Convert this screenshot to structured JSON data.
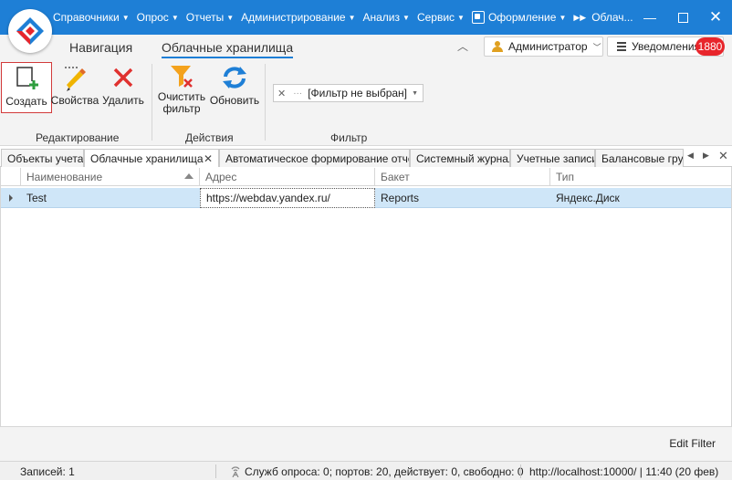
{
  "menu": {
    "items": [
      {
        "label": "Справочники"
      },
      {
        "label": "Опрос"
      },
      {
        "label": "Отчеты"
      },
      {
        "label": "Администрирование"
      },
      {
        "label": "Анализ"
      },
      {
        "label": "Сервис"
      },
      {
        "label": "Оформление"
      }
    ],
    "window_tab": "Облач..."
  },
  "ribbon_tabs": {
    "navigation": "Навигация",
    "cloud": "Облачные хранилища"
  },
  "user": {
    "name": "Администратор",
    "notifications_label": "Уведомления",
    "notifications_count": "1880"
  },
  "ribbon": {
    "create": "Создать",
    "properties": "Свойства",
    "delete": "Удалить",
    "clear_filter_l1": "Очистить",
    "clear_filter_l2": "фильтр",
    "refresh": "Обновить",
    "filter_placeholder": "[Фильтр не выбран]",
    "group_editing": "Редактирование",
    "group_actions": "Действия",
    "group_filter": "Фильтр"
  },
  "doc_tabs": [
    {
      "label": "Объекты учета"
    },
    {
      "label": "Облачные хранилища"
    },
    {
      "label": "Автоматическое формирование отчёто"
    },
    {
      "label": "Системный журнал"
    },
    {
      "label": "Учетные записи"
    },
    {
      "label": "Балансовые групп"
    }
  ],
  "grid": {
    "columns": [
      "Наименование",
      "Адрес",
      "Бакет",
      "Тип"
    ],
    "rows": [
      {
        "name": "Test",
        "address": "https://webdav.yandex.ru/",
        "bucket": "Reports",
        "type": "Яндекс.Диск"
      }
    ],
    "edit_filter": "Edit Filter"
  },
  "status": {
    "records": "Записей: 1",
    "services": "Служб опроса: 0; портов: 20, действует: 0, свободно: 0",
    "server": "http://localhost:10000/ | 11:40 (20 фев)"
  },
  "colors": {
    "titlebar": "#1e7fd6",
    "badge": "#e8252b",
    "selected_row": "#cfe6f8"
  }
}
